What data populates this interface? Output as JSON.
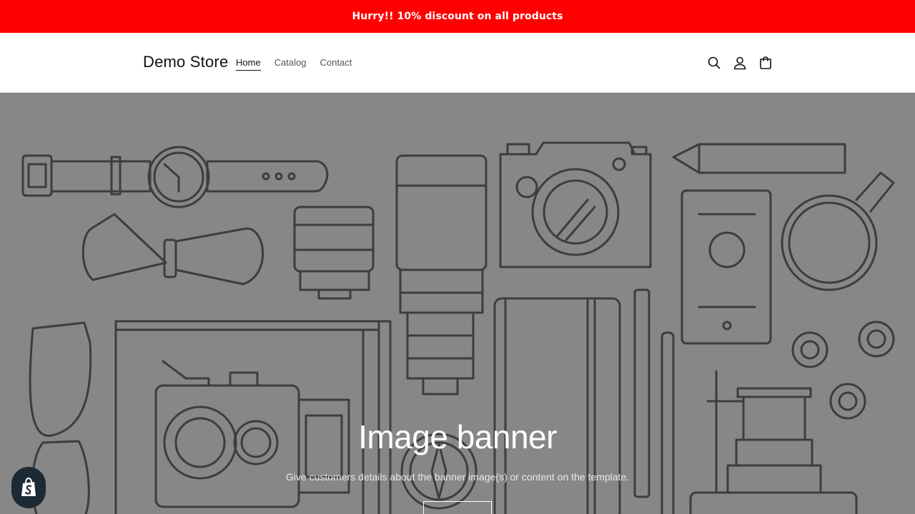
{
  "announcement": {
    "text": "Hurry!! 10% discount on all products",
    "background": "#ff0000"
  },
  "header": {
    "logo": "Demo Store",
    "nav": [
      {
        "label": "Home",
        "active": true
      },
      {
        "label": "Catalog",
        "active": false
      },
      {
        "label": "Contact",
        "active": false
      }
    ],
    "icons": [
      "search-icon",
      "account-icon",
      "cart-icon"
    ]
  },
  "banner": {
    "title": "Image banner",
    "text": "Give customers details about the banner image(s) or content on the template.",
    "background": "#878787",
    "line_color": "#3d3d3d"
  },
  "badge": {
    "icon": "shopify-bag-icon"
  }
}
